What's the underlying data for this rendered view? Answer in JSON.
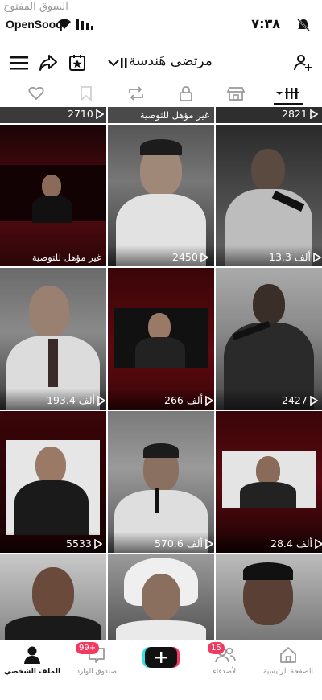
{
  "watermark": "السوق المفتوح",
  "status_bar": {
    "brand": "OpenSooq",
    "time": "٧:٣٨"
  },
  "header": {
    "username": "مرتضى هَندسة"
  },
  "grid": {
    "items": [
      {
        "views": "2710",
        "caption": ""
      },
      {
        "views": "",
        "caption": "غير مؤهل للتوصية"
      },
      {
        "views": "2821",
        "caption": ""
      },
      {
        "views": "",
        "caption": "غير مؤهل للتوصية"
      },
      {
        "views": "2450",
        "caption": ""
      },
      {
        "views": "13.3 ألف",
        "caption": ""
      },
      {
        "views": "193.4 ألف",
        "caption": ""
      },
      {
        "views": "266 ألف",
        "caption": ""
      },
      {
        "views": "2427",
        "caption": ""
      },
      {
        "views": "5533",
        "caption": ""
      },
      {
        "views": "570.6 ألف",
        "caption": ""
      },
      {
        "views": "28.4 ألف",
        "caption": ""
      },
      {
        "views": "",
        "caption": ""
      },
      {
        "views": "",
        "caption": ""
      },
      {
        "views": "",
        "caption": ""
      }
    ]
  },
  "bottom_nav": {
    "items": [
      {
        "label": "الملف الشخصي",
        "active": true
      },
      {
        "label": "صندوق الوارد",
        "badge": "99+"
      },
      {
        "label": ""
      },
      {
        "label": "الأصدقاء",
        "badge": "15"
      },
      {
        "label": "الصفحة الرئيسية"
      }
    ]
  },
  "colors": {
    "badge": "#f03a5f",
    "create_left": "#35e0e8",
    "create_right": "#f03a5f"
  }
}
